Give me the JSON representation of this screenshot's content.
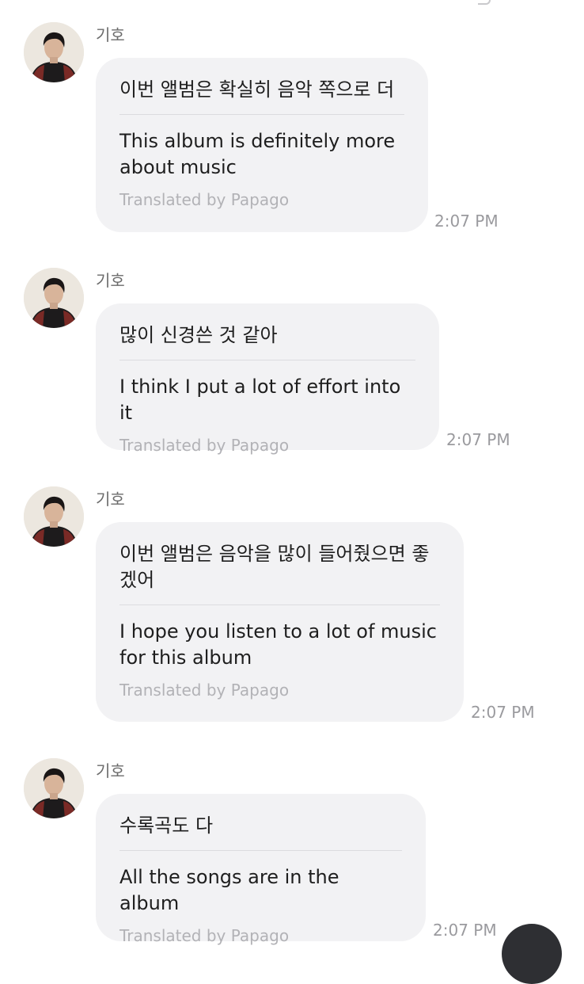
{
  "messages": [
    {
      "sender": "기호",
      "original": "이번 앨범은 확실히 음악 쪽으로 더",
      "translation": "This album is definitely more\nabout music",
      "credit": "Translated by Papago",
      "time": "2:07 PM"
    },
    {
      "sender": "기호",
      "original": "많이 신경쓴 것 같아",
      "translation": "I think I put a lot of effort into it",
      "credit": "Translated by Papago",
      "time": "2:07 PM"
    },
    {
      "sender": "기호",
      "original": "이번 앨범은 음악을 많이 들어줬으면 좋\n겠어",
      "translation": "I hope you listen to a lot of music\nfor this album",
      "credit": "Translated by Papago",
      "time": "2:07 PM"
    },
    {
      "sender": "기호",
      "original": "수록곡도 다",
      "translation": "All the songs are in the album",
      "credit": "Translated by Papago",
      "time": "2:07 PM"
    }
  ],
  "icons": {
    "avatar": "profile-photo",
    "fab": "floating-action-button"
  },
  "colors": {
    "bubble": "#f2f2f4",
    "text": "#1e1e1e",
    "muted": "#b2b2b6",
    "time": "#9a9a9e"
  }
}
